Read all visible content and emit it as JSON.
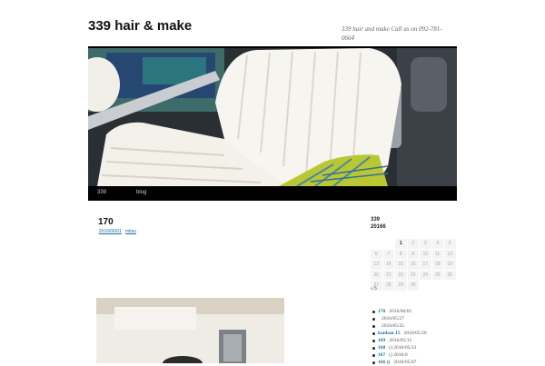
{
  "site": {
    "title": "339 hair & make",
    "description": "339 hair and make Call us on 092-781-0664"
  },
  "nav": {
    "items": [
      "339",
      "blog"
    ]
  },
  "post": {
    "title": "170",
    "meta_prefix": ":",
    "date": "2016/06/01",
    "author": "mitsu"
  },
  "sidebar": {
    "calendar_title": "339",
    "calendar_caption": "20166",
    "calendar_weeks": [
      [
        "",
        "",
        "",
        "1",
        "2",
        "3",
        "4",
        "5"
      ],
      [
        "6",
        "7",
        "8",
        "9",
        "10",
        "11",
        "12"
      ],
      [
        "13",
        "14",
        "15",
        "16",
        "17",
        "18",
        "19"
      ],
      [
        "20",
        "21",
        "22",
        "23",
        "24",
        "25",
        "26"
      ],
      [
        "27",
        "28",
        "29",
        "30",
        "",
        "",
        ""
      ]
    ],
    "calendar_prev": "« 5",
    "recent": [
      {
        "title": "170",
        "date": "2016/06/01"
      },
      {
        "title": "",
        "date": "2016/05/27"
      },
      {
        "title": "",
        "date": "2016/05/25"
      },
      {
        "title": "kanban 15",
        "date": "2016/05/20"
      },
      {
        "title": "169",
        "date": "2016/05/15"
      },
      {
        "title": "168",
        "date": "()        2016/05/12"
      },
      {
        "title": "167",
        "date": "()        2016/0"
      },
      {
        "title": "166 ()",
        "date": "2016/05/07"
      }
    ]
  }
}
